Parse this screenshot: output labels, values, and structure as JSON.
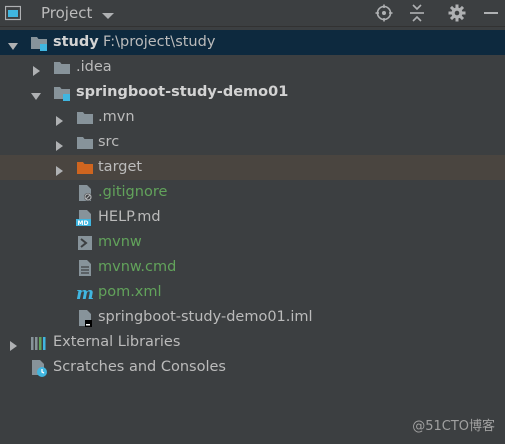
{
  "toolbar": {
    "title": "Project",
    "icons": [
      "project-view-icon",
      "dropdown-arrow-icon",
      "locate-icon",
      "collapse-all-icon",
      "settings-gear-icon",
      "hide-icon"
    ]
  },
  "tree": {
    "root": {
      "label": "study",
      "path": "F:\\project\\study"
    },
    "idea": {
      "label": ".idea"
    },
    "module": {
      "label": "springboot-study-demo01"
    },
    "mvn": {
      "label": ".mvn"
    },
    "src": {
      "label": "src"
    },
    "target": {
      "label": "target"
    },
    "gitignore": {
      "label": ".gitignore"
    },
    "help": {
      "label": "HELP.md"
    },
    "mvnw": {
      "label": "mvnw"
    },
    "mvnw_cmd": {
      "label": "mvnw.cmd"
    },
    "pom": {
      "label": "pom.xml"
    },
    "iml": {
      "label": "springboot-study-demo01.iml"
    },
    "ext_libs": {
      "label": "External Libraries"
    },
    "scratches": {
      "label": "Scratches and Consoles"
    }
  },
  "watermark": "@51CTO博客",
  "colors": {
    "background": "#3c3f41",
    "selected_row": "#0d293e",
    "excluded_row": "#4a4540",
    "untracked_green": "#62a35b",
    "excluded_folder": "#d0651f",
    "folder": "#87939a",
    "module_accent": "#40b6e0"
  }
}
